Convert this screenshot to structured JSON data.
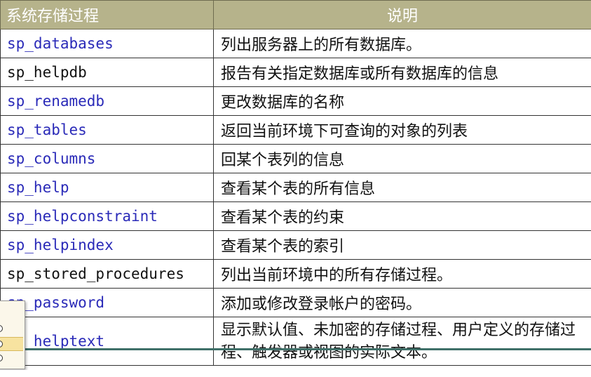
{
  "table": {
    "headers": {
      "procedure": "系统存储过程",
      "description": "说明"
    },
    "rows": [
      {
        "name": "sp_databases",
        "desc": "列出服务器上的所有数据库。",
        "style": "link"
      },
      {
        "name": "sp_helpdb",
        "desc": "报告有关指定数据库或所有数据库的信息",
        "style": "plain"
      },
      {
        "name": "sp_renamedb",
        "desc": "更改数据库的名称",
        "style": "link"
      },
      {
        "name": "sp_tables",
        "desc": "返回当前环境下可查询的对象的列表",
        "style": "link"
      },
      {
        "name": "sp_columns",
        "desc": "回某个表列的信息",
        "style": "link"
      },
      {
        "name": "sp_help",
        "desc": "查看某个表的所有信息",
        "style": "link"
      },
      {
        "name": "sp_helpconstraint",
        "desc": "查看某个表的约束",
        "style": "link"
      },
      {
        "name": "sp_helpindex",
        "desc": "查看某个表的索引",
        "style": "link"
      },
      {
        "name": "sp_stored_procedures",
        "desc": "列出当前环境中的所有存储过程。",
        "style": "plain"
      },
      {
        "name": "sp_password",
        "desc": "添加或修改登录帐户的密码。",
        "style": "link"
      },
      {
        "name": "sp_helptext",
        "desc": "显示默认值、未加密的存储过程、用户定义的存储过程、触发器或视图的实际文本。",
        "style": "link"
      }
    ]
  },
  "colors": {
    "header_bg": "#b6b38b",
    "link_text": "#2a2ab8",
    "overlay_line": "#3f6f68"
  }
}
